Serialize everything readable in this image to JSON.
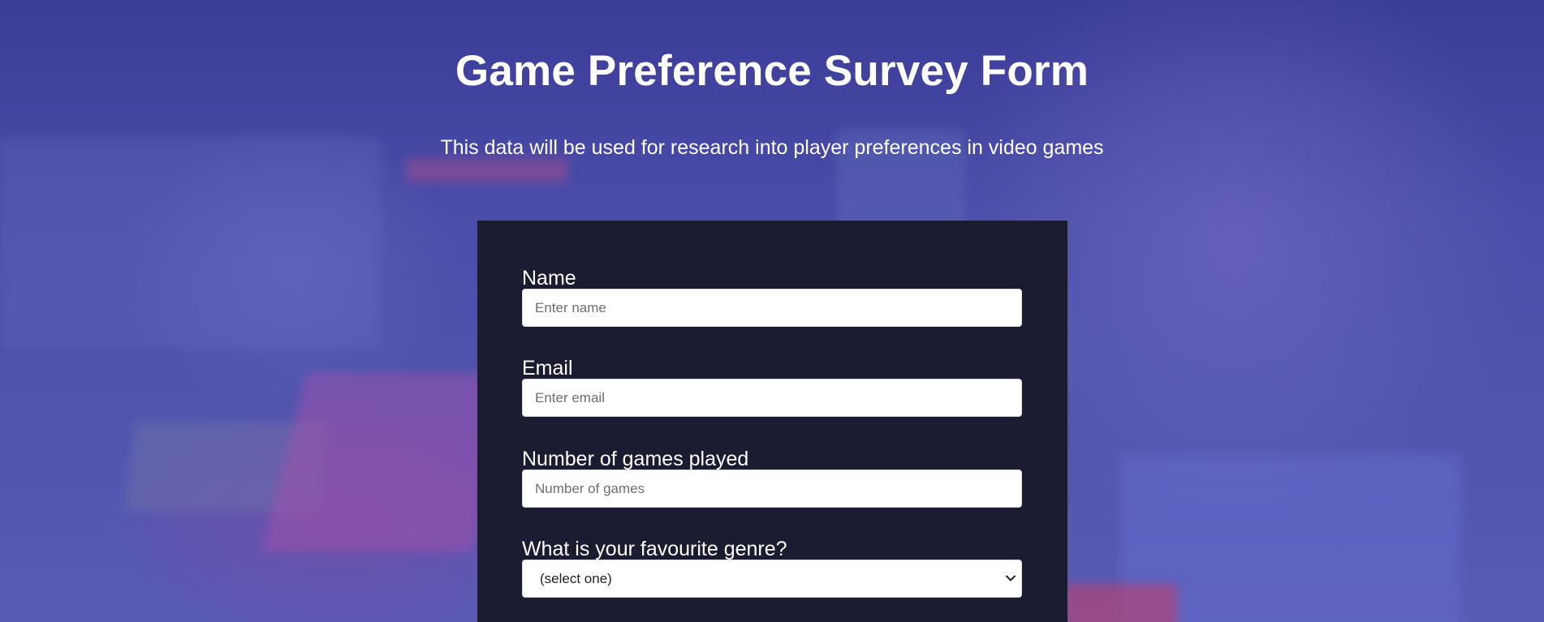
{
  "header": {
    "title": "Game Preference Survey Form",
    "description": "This data will be used for research into player preferences in video games"
  },
  "form": {
    "name": {
      "label": "Name",
      "placeholder": "Enter name"
    },
    "email": {
      "label": "Email",
      "placeholder": "Enter email"
    },
    "games_played": {
      "label": "Number of games played",
      "placeholder": "Number of games"
    },
    "genre": {
      "label": "What is your favourite genre?",
      "selected": "(select one)",
      "icon": "chevron-down-icon"
    }
  },
  "colors": {
    "background_overlay": "#4b4fa6",
    "form_background": "#1b1b32",
    "text": "#ffffff"
  }
}
